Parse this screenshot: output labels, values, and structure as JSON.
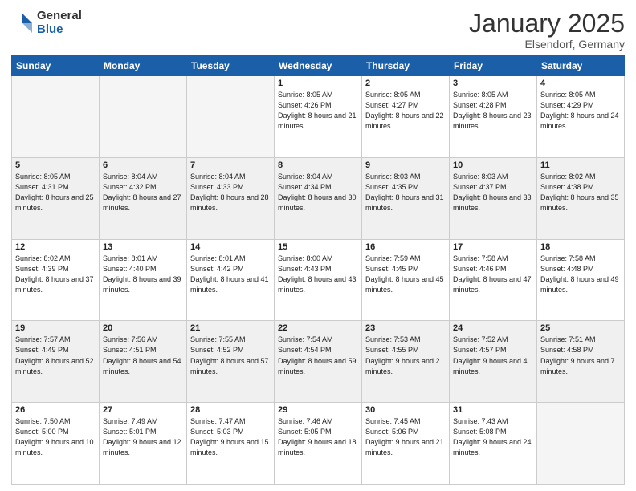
{
  "header": {
    "logo_general": "General",
    "logo_blue": "Blue",
    "month_title": "January 2025",
    "location": "Elsendorf, Germany"
  },
  "days_of_week": [
    "Sunday",
    "Monday",
    "Tuesday",
    "Wednesday",
    "Thursday",
    "Friday",
    "Saturday"
  ],
  "weeks": [
    {
      "shaded": false,
      "days": [
        {
          "number": "",
          "info": ""
        },
        {
          "number": "",
          "info": ""
        },
        {
          "number": "",
          "info": ""
        },
        {
          "number": "1",
          "info": "Sunrise: 8:05 AM\nSunset: 4:26 PM\nDaylight: 8 hours\nand 21 minutes."
        },
        {
          "number": "2",
          "info": "Sunrise: 8:05 AM\nSunset: 4:27 PM\nDaylight: 8 hours\nand 22 minutes."
        },
        {
          "number": "3",
          "info": "Sunrise: 8:05 AM\nSunset: 4:28 PM\nDaylight: 8 hours\nand 23 minutes."
        },
        {
          "number": "4",
          "info": "Sunrise: 8:05 AM\nSunset: 4:29 PM\nDaylight: 8 hours\nand 24 minutes."
        }
      ]
    },
    {
      "shaded": true,
      "days": [
        {
          "number": "5",
          "info": "Sunrise: 8:05 AM\nSunset: 4:31 PM\nDaylight: 8 hours\nand 25 minutes."
        },
        {
          "number": "6",
          "info": "Sunrise: 8:04 AM\nSunset: 4:32 PM\nDaylight: 8 hours\nand 27 minutes."
        },
        {
          "number": "7",
          "info": "Sunrise: 8:04 AM\nSunset: 4:33 PM\nDaylight: 8 hours\nand 28 minutes."
        },
        {
          "number": "8",
          "info": "Sunrise: 8:04 AM\nSunset: 4:34 PM\nDaylight: 8 hours\nand 30 minutes."
        },
        {
          "number": "9",
          "info": "Sunrise: 8:03 AM\nSunset: 4:35 PM\nDaylight: 8 hours\nand 31 minutes."
        },
        {
          "number": "10",
          "info": "Sunrise: 8:03 AM\nSunset: 4:37 PM\nDaylight: 8 hours\nand 33 minutes."
        },
        {
          "number": "11",
          "info": "Sunrise: 8:02 AM\nSunset: 4:38 PM\nDaylight: 8 hours\nand 35 minutes."
        }
      ]
    },
    {
      "shaded": false,
      "days": [
        {
          "number": "12",
          "info": "Sunrise: 8:02 AM\nSunset: 4:39 PM\nDaylight: 8 hours\nand 37 minutes."
        },
        {
          "number": "13",
          "info": "Sunrise: 8:01 AM\nSunset: 4:40 PM\nDaylight: 8 hours\nand 39 minutes."
        },
        {
          "number": "14",
          "info": "Sunrise: 8:01 AM\nSunset: 4:42 PM\nDaylight: 8 hours\nand 41 minutes."
        },
        {
          "number": "15",
          "info": "Sunrise: 8:00 AM\nSunset: 4:43 PM\nDaylight: 8 hours\nand 43 minutes."
        },
        {
          "number": "16",
          "info": "Sunrise: 7:59 AM\nSunset: 4:45 PM\nDaylight: 8 hours\nand 45 minutes."
        },
        {
          "number": "17",
          "info": "Sunrise: 7:58 AM\nSunset: 4:46 PM\nDaylight: 8 hours\nand 47 minutes."
        },
        {
          "number": "18",
          "info": "Sunrise: 7:58 AM\nSunset: 4:48 PM\nDaylight: 8 hours\nand 49 minutes."
        }
      ]
    },
    {
      "shaded": true,
      "days": [
        {
          "number": "19",
          "info": "Sunrise: 7:57 AM\nSunset: 4:49 PM\nDaylight: 8 hours\nand 52 minutes."
        },
        {
          "number": "20",
          "info": "Sunrise: 7:56 AM\nSunset: 4:51 PM\nDaylight: 8 hours\nand 54 minutes."
        },
        {
          "number": "21",
          "info": "Sunrise: 7:55 AM\nSunset: 4:52 PM\nDaylight: 8 hours\nand 57 minutes."
        },
        {
          "number": "22",
          "info": "Sunrise: 7:54 AM\nSunset: 4:54 PM\nDaylight: 8 hours\nand 59 minutes."
        },
        {
          "number": "23",
          "info": "Sunrise: 7:53 AM\nSunset: 4:55 PM\nDaylight: 9 hours\nand 2 minutes."
        },
        {
          "number": "24",
          "info": "Sunrise: 7:52 AM\nSunset: 4:57 PM\nDaylight: 9 hours\nand 4 minutes."
        },
        {
          "number": "25",
          "info": "Sunrise: 7:51 AM\nSunset: 4:58 PM\nDaylight: 9 hours\nand 7 minutes."
        }
      ]
    },
    {
      "shaded": false,
      "days": [
        {
          "number": "26",
          "info": "Sunrise: 7:50 AM\nSunset: 5:00 PM\nDaylight: 9 hours\nand 10 minutes."
        },
        {
          "number": "27",
          "info": "Sunrise: 7:49 AM\nSunset: 5:01 PM\nDaylight: 9 hours\nand 12 minutes."
        },
        {
          "number": "28",
          "info": "Sunrise: 7:47 AM\nSunset: 5:03 PM\nDaylight: 9 hours\nand 15 minutes."
        },
        {
          "number": "29",
          "info": "Sunrise: 7:46 AM\nSunset: 5:05 PM\nDaylight: 9 hours\nand 18 minutes."
        },
        {
          "number": "30",
          "info": "Sunrise: 7:45 AM\nSunset: 5:06 PM\nDaylight: 9 hours\nand 21 minutes."
        },
        {
          "number": "31",
          "info": "Sunrise: 7:43 AM\nSunset: 5:08 PM\nDaylight: 9 hours\nand 24 minutes."
        },
        {
          "number": "",
          "info": ""
        }
      ]
    }
  ]
}
